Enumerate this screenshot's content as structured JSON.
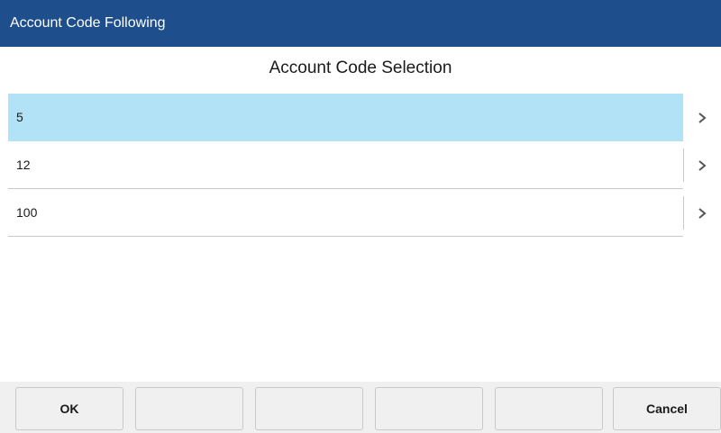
{
  "window": {
    "title": "Account Code Following"
  },
  "main": {
    "heading": "Account Code Selection",
    "items": [
      {
        "label": "5",
        "selected": true,
        "icon": "chevron-right-icon"
      },
      {
        "label": "12",
        "selected": false,
        "icon": "chevron-right-icon"
      },
      {
        "label": "100",
        "selected": false,
        "icon": "chevron-right-icon"
      }
    ]
  },
  "softkeys": [
    {
      "label": "OK"
    },
    {
      "label": ""
    },
    {
      "label": ""
    },
    {
      "label": ""
    },
    {
      "label": ""
    },
    {
      "label": "Cancel"
    }
  ],
  "colors": {
    "titlebar": "#1f4e8c",
    "selected_row": "#b2e2f5"
  }
}
